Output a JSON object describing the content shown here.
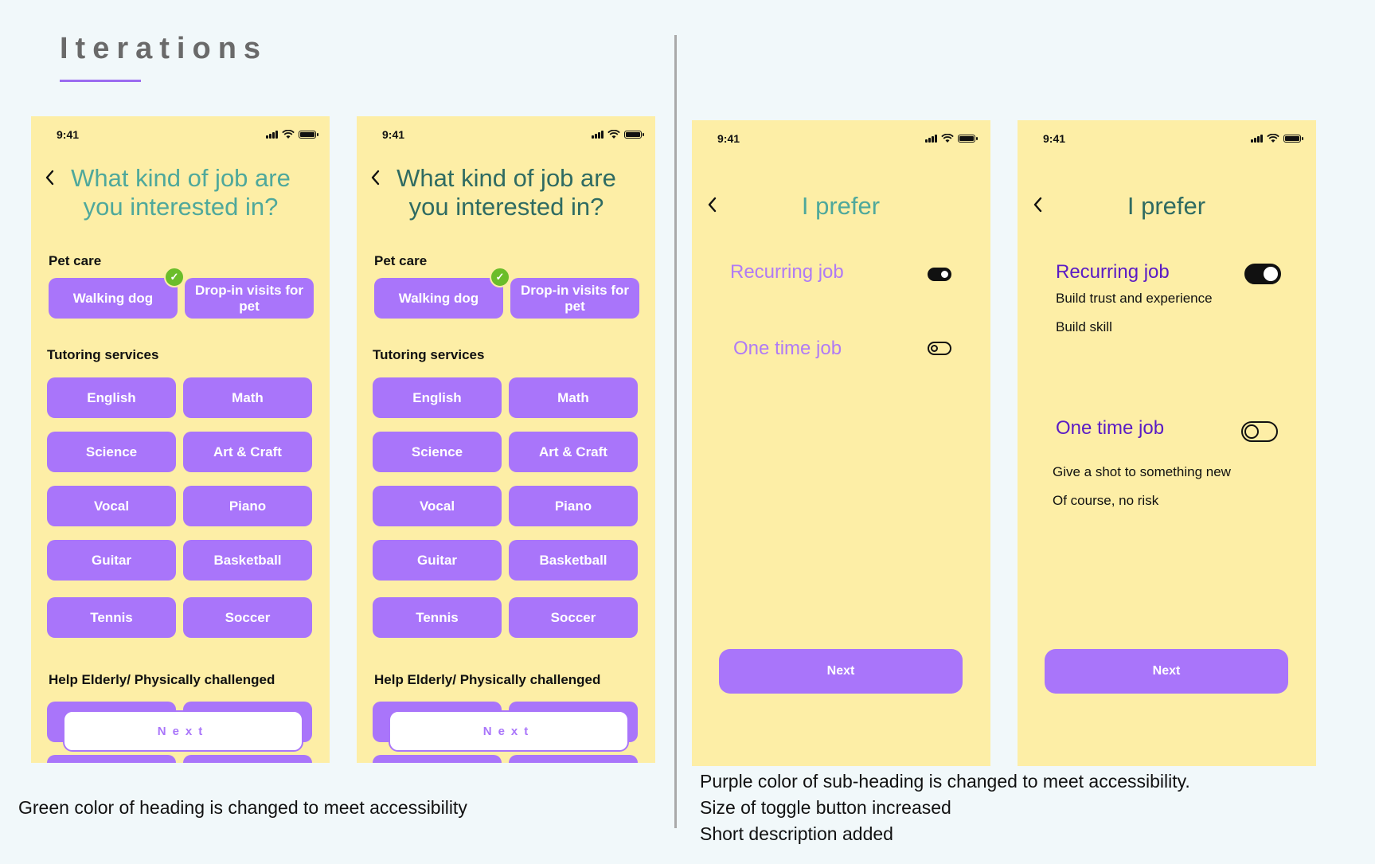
{
  "page": {
    "title": "Iterations",
    "left_note": "Green color of heading is changed to meet accessibility",
    "right_notes": [
      "Purple color of sub-heading is changed to meet accessibility.",
      "Size of toggle button increased",
      "Short description added"
    ]
  },
  "colors": {
    "background": "#f1f8fa",
    "phone_bg": "#fdeea6",
    "chip": "#a975fa",
    "heading_green_before": "#4fa89b",
    "heading_green_after": "#2f6b62",
    "purple_before": "#b07bf5",
    "purple_after": "#5a1bc5",
    "check_green": "#6bbd2a",
    "title_underline": "#9b6cf0"
  },
  "status_bar": {
    "time": "9:41"
  },
  "job_screen": {
    "heading_line1": "What kind of job are",
    "heading_line2": "you interested in?",
    "sections": {
      "pet_care": "Pet care",
      "tutoring": "Tutoring services",
      "elderly": "Help Elderly/ Physically challenged"
    },
    "pet_options": [
      "Walking dog",
      "Drop-in visits for pet"
    ],
    "tutoring_options": [
      "English",
      "Math",
      "Science",
      "Art & Craft",
      "Vocal",
      "Piano",
      "Guitar",
      "Basketball",
      "Tennis",
      "Soccer"
    ],
    "selected": "Walking dog",
    "next_label": "Next"
  },
  "pref_screen_v1": {
    "heading": "I prefer",
    "recurring_label": "Recurring job",
    "recurring_on": true,
    "onetime_label": "One time job",
    "onetime_on": false,
    "next_label": "Next"
  },
  "pref_screen_v2": {
    "heading": "I prefer",
    "recurring_label": "Recurring job",
    "recurring_on": true,
    "recurring_desc": [
      "Build trust and experience",
      "Build skill"
    ],
    "onetime_label": "One time job",
    "onetime_on": false,
    "onetime_desc": [
      "Give a shot to something new",
      "Of course, no risk"
    ],
    "next_label": "Next"
  }
}
